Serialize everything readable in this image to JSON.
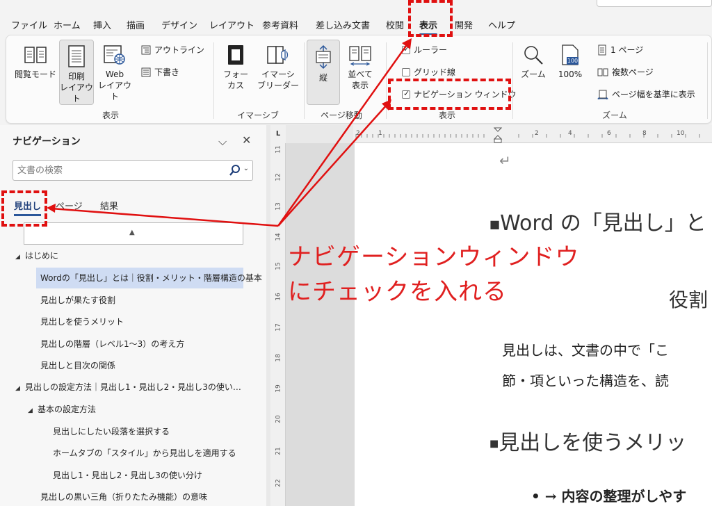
{
  "menu": {
    "tabs": [
      "ファイル",
      "ホーム",
      "挿入",
      "描画",
      "デザイン",
      "レイアウト",
      "参考資料",
      "差し込み文書",
      "校閲",
      "表示",
      "開発",
      "ヘルプ"
    ]
  },
  "ribbon": {
    "views": {
      "read_mode": "閲覧モード",
      "print_layout_1": "印刷",
      "print_layout_2": "レイアウト",
      "web_layout_1": "Web",
      "web_layout_2": "レイアウト",
      "outline": "アウトライン",
      "draft": "下書き",
      "group_label": "表示"
    },
    "immersive": {
      "focus_1": "フォー",
      "focus_2": "カス",
      "reader_1": "イマーシ",
      "reader_2": "ブリーダー",
      "group_label": "イマーシブ"
    },
    "page_movement": {
      "vertical": "縦",
      "side_1": "並べて",
      "side_2": "表示",
      "group_label": "ページ移動"
    },
    "show": {
      "ruler": "ルーラー",
      "gridlines": "グリッド線",
      "nav_pane": "ナビゲーション ウィンドウ",
      "group_label": "表示"
    },
    "zoom": {
      "zoom": "ズーム",
      "pct": "100%",
      "pct_icon": "100",
      "one_page": "1 ページ",
      "multi_page": "複数ページ",
      "page_width": "ページ幅を基準に表示",
      "group_label": "ズーム"
    }
  },
  "nav": {
    "title": "ナビゲーション",
    "search_placeholder": "文書の検索",
    "tabs": [
      "見出し",
      "ページ",
      "結果"
    ],
    "headings": [
      "はじめに",
      "Wordの「見出し」とは｜役割・メリット・階層構造の基本",
      "見出しが果たす役割",
      "見出しを使うメリット",
      "見出しの階層（レベル1〜3）の考え方",
      "見出しと目次の関係",
      "見出しの設定方法｜見出し1・見出し2・見出し3の使い…",
      "基本の設定方法",
      "見出しにしたい段落を選択する",
      "ホームタブの「スタイル」から見出しを適用する",
      "見出し1・見出し2・見出し3の使い分け",
      "見出しの黒い三角（折りたたみ機能）の意味"
    ]
  },
  "ruler": {
    "h": [
      "2",
      "1",
      "2",
      "4",
      "6",
      "8",
      "10"
    ],
    "v": [
      "11",
      "12",
      "13",
      "14",
      "15",
      "16",
      "17",
      "18",
      "19",
      "20",
      "21",
      "22"
    ]
  },
  "document": {
    "return_mark": "↵",
    "heading1": "Word の「見出し」と",
    "subheading": "役割",
    "para1": "見出しは、文書の中で「こ",
    "para2": "節・項といった構造を、読",
    "heading2": "見出しを使うメリッ",
    "bullet": "→ 内容の整理がしやす"
  },
  "annotation": {
    "line1": "ナビゲーションウィンドウ",
    "line2": "にチェックを入れる"
  },
  "colors": {
    "accent": "#2b579a",
    "annotation": "#e02020",
    "selected": "#cfdcf3"
  }
}
